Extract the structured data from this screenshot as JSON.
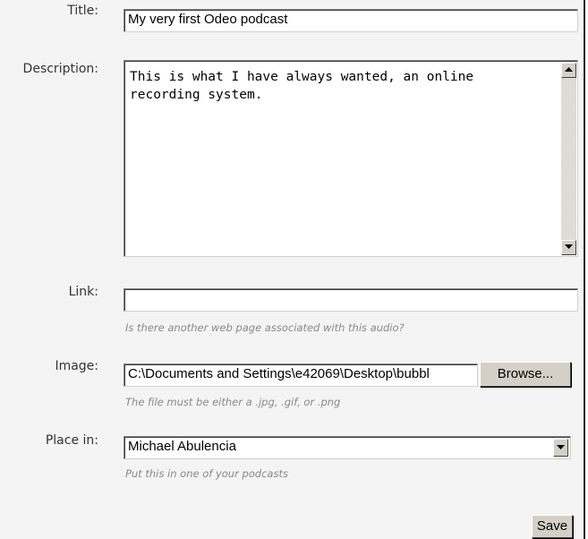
{
  "form": {
    "title": {
      "label": "Title:",
      "value": "My very first Odeo podcast"
    },
    "description": {
      "label": "Description:",
      "value": "This is what I have always wanted, an online recording system."
    },
    "link": {
      "label": "Link:",
      "value": "",
      "hint": "Is there another web page associated with this audio?"
    },
    "image": {
      "label": "Image:",
      "value": "C:\\Documents and Settings\\e42069\\Desktop\\bubbl",
      "browse_label": "Browse...",
      "hint": "The file must be either a .jpg, .gif, or .png"
    },
    "place_in": {
      "label": "Place in:",
      "selected": "Michael Abulencia",
      "hint": "Put this in one of your podcasts"
    },
    "save_label": "Save"
  },
  "icons": {
    "scroll_up": "scroll-up-arrow-icon",
    "scroll_down": "scroll-down-arrow-icon",
    "dropdown": "chevron-down-icon"
  },
  "colors": {
    "background": "#f4f4f4",
    "button_face": "#d4d0c8",
    "hint_text": "#888888"
  }
}
